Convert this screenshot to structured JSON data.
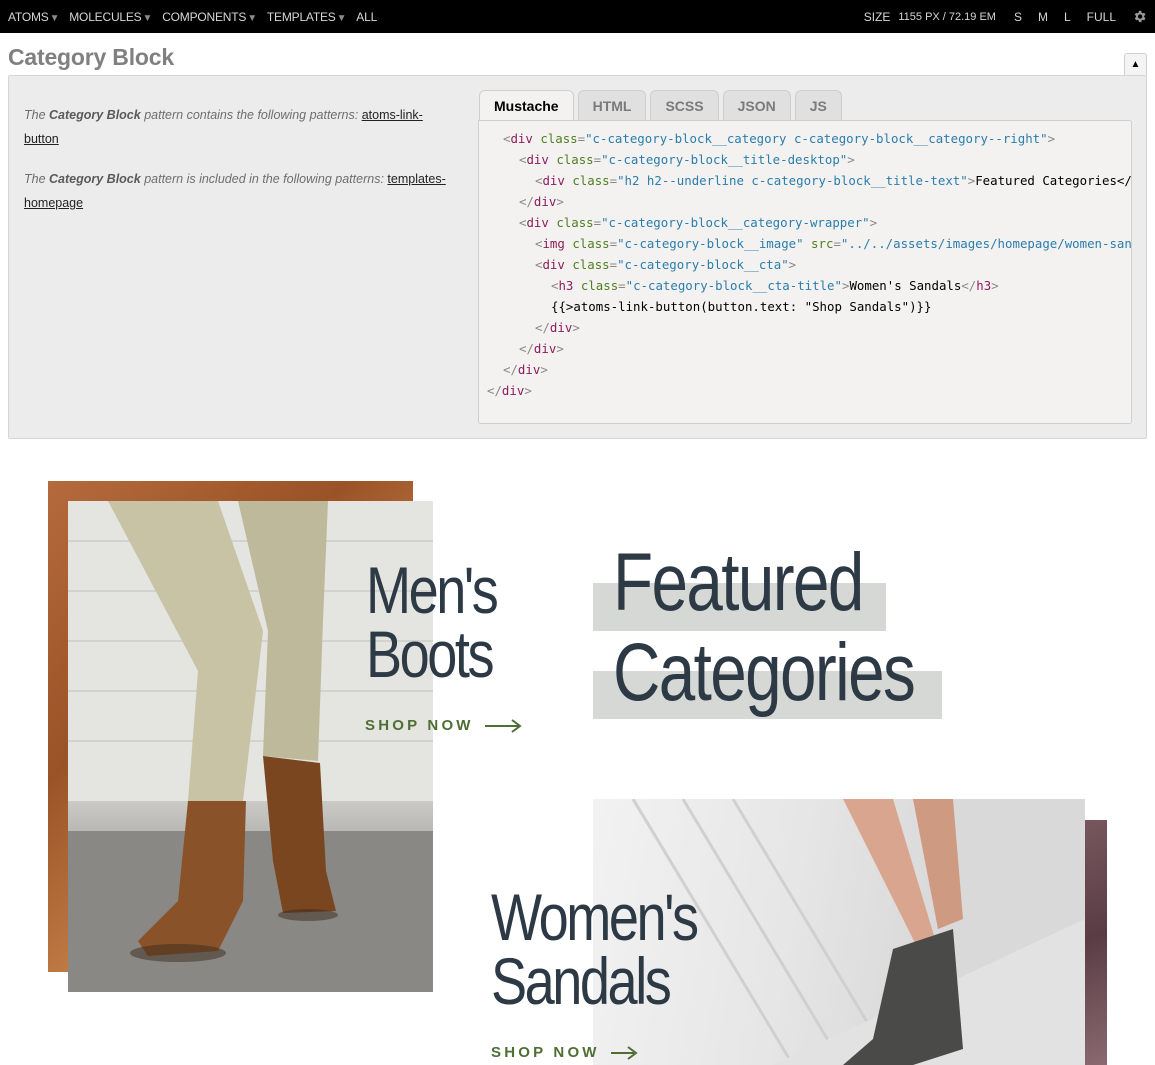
{
  "nav": {
    "items": [
      {
        "label": "ATOMS",
        "dropdown": true
      },
      {
        "label": "MOLECULES",
        "dropdown": true
      },
      {
        "label": "COMPONENTS",
        "dropdown": true
      },
      {
        "label": "TEMPLATES",
        "dropdown": true
      },
      {
        "label": "ALL",
        "dropdown": false
      }
    ],
    "size_label": "SIZE",
    "size_px": "1155 PX /",
    "size_em": "72.19 EM",
    "viewports": [
      "S",
      "M",
      "L",
      "FULL"
    ],
    "settings_icon": "gear-icon",
    "caret": "▼"
  },
  "pattern": {
    "title": "Category Block",
    "collapse_glyph": "▲",
    "desc1_pre": "The ",
    "desc1_name": "Category Block",
    "desc1_post": " pattern contains the following patterns: ",
    "desc1_link": "atoms-link-button",
    "desc2_pre": "The ",
    "desc2_name": "Category Block",
    "desc2_post": " pattern is included in the following patterns: ",
    "desc2_link": "templates-homepage",
    "tabs": [
      "Mustache",
      "HTML",
      "SCSS",
      "JSON",
      "JS"
    ],
    "active_tab": "Mustache"
  },
  "code_lines": [
    {
      "indent": 1,
      "tokens": [
        [
          "pu",
          "<"
        ],
        [
          "tg",
          "div"
        ],
        [
          "at",
          " class"
        ],
        [
          "pu",
          "="
        ],
        [
          "vl",
          "\"c-category-block__category c-category-block__category--right\""
        ],
        [
          "pu",
          ">"
        ]
      ]
    },
    {
      "indent": 2,
      "tokens": [
        [
          "pu",
          "<"
        ],
        [
          "tg",
          "div"
        ],
        [
          "at",
          " class"
        ],
        [
          "pu",
          "="
        ],
        [
          "vl",
          "\"c-category-block__title-desktop\""
        ],
        [
          "pu",
          ">"
        ]
      ]
    },
    {
      "indent": 3,
      "tokens": [
        [
          "pu",
          "<"
        ],
        [
          "tg",
          "div"
        ],
        [
          "at",
          " class"
        ],
        [
          "pu",
          "="
        ],
        [
          "vl",
          "\"h2 h2--underline c-category-block__title-text\""
        ],
        [
          "pu",
          ">"
        ],
        [
          "tx",
          "Featured Categories</div>"
        ]
      ]
    },
    {
      "indent": 2,
      "tokens": [
        [
          "pu",
          "</"
        ],
        [
          "tg",
          "div"
        ],
        [
          "pu",
          ">"
        ]
      ]
    },
    {
      "indent": 2,
      "tokens": [
        [
          "pu",
          "<"
        ],
        [
          "tg",
          "div"
        ],
        [
          "at",
          " class"
        ],
        [
          "pu",
          "="
        ],
        [
          "vl",
          "\"c-category-block__category-wrapper\""
        ],
        [
          "pu",
          ">"
        ]
      ]
    },
    {
      "indent": 3,
      "tokens": [
        [
          "pu",
          "<"
        ],
        [
          "tg",
          "img"
        ],
        [
          "at",
          " class"
        ],
        [
          "pu",
          "="
        ],
        [
          "vl",
          "\"c-category-block__image\""
        ],
        [
          "at",
          " src"
        ],
        [
          "pu",
          "="
        ],
        [
          "vl",
          "\"../../assets/images/homepage/women-sandals.jpg\""
        ],
        [
          "pu",
          ">"
        ]
      ]
    },
    {
      "indent": 3,
      "tokens": [
        [
          "pu",
          "<"
        ],
        [
          "tg",
          "div"
        ],
        [
          "at",
          " class"
        ],
        [
          "pu",
          "="
        ],
        [
          "vl",
          "\"c-category-block__cta\""
        ],
        [
          "pu",
          ">"
        ]
      ]
    },
    {
      "indent": 4,
      "tokens": [
        [
          "pu",
          "<"
        ],
        [
          "tg",
          "h3"
        ],
        [
          "at",
          " class"
        ],
        [
          "pu",
          "="
        ],
        [
          "vl",
          "\"c-category-block__cta-title\""
        ],
        [
          "pu",
          ">"
        ],
        [
          "tx",
          "Women's Sandals"
        ],
        [
          "pu",
          "</"
        ],
        [
          "tg",
          "h3"
        ],
        [
          "pu",
          ">"
        ]
      ]
    },
    {
      "indent": 4,
      "tokens": [
        [
          "tx",
          "{{>atoms-link-button(button.text: \"Shop Sandals\")}}"
        ]
      ]
    },
    {
      "indent": 3,
      "tokens": [
        [
          "pu",
          "</"
        ],
        [
          "tg",
          "div"
        ],
        [
          "pu",
          ">"
        ]
      ]
    },
    {
      "indent": 2,
      "tokens": [
        [
          "pu",
          "</"
        ],
        [
          "tg",
          "div"
        ],
        [
          "pu",
          ">"
        ]
      ]
    },
    {
      "indent": 1,
      "tokens": [
        [
          "pu",
          "</"
        ],
        [
          "tg",
          "div"
        ],
        [
          "pu",
          ">"
        ]
      ]
    },
    {
      "indent": 0,
      "tokens": [
        [
          "pu",
          "</"
        ],
        [
          "tg",
          "div"
        ],
        [
          "pu",
          ">"
        ]
      ]
    }
  ],
  "category_block": {
    "men_title_line1": "Men's",
    "men_title_line2": "Boots",
    "men_cta": "SHOP NOW",
    "featured_line1": "Featured",
    "featured_line2": "Categories",
    "women_title_line1": "Women's",
    "women_title_line2": "Sandals",
    "women_cta": "SHOP NOW"
  },
  "colors": {
    "heading": "#2d3a45",
    "cta_green": "#4f6e33",
    "highlight": "#d5d8d4"
  }
}
